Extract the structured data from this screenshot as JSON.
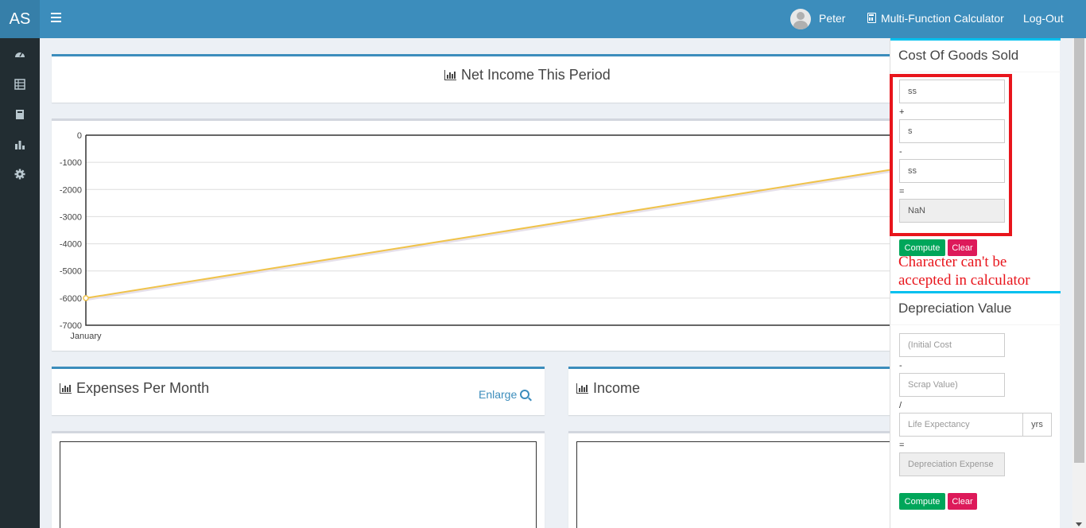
{
  "app": {
    "logo": "AS"
  },
  "header": {
    "user_name": "Peter",
    "calculator_label": "Multi-Function Calculator",
    "logout_label": "Log-Out"
  },
  "sidebar": {
    "items": [
      {
        "icon": "dashboard-icon"
      },
      {
        "icon": "table-icon"
      },
      {
        "icon": "book-icon"
      },
      {
        "icon": "bar-chart-icon"
      },
      {
        "icon": "gear-icon"
      }
    ]
  },
  "net_income": {
    "title": "Net Income This Period"
  },
  "chart_data": {
    "type": "line",
    "title": "",
    "categories": [
      "January"
    ],
    "yticks": [
      "0",
      "-1000",
      "-2000",
      "-3000",
      "-4000",
      "-5000",
      "-6000",
      "-7000"
    ],
    "ylim": [
      -7000,
      0
    ],
    "series": [
      {
        "values": [
          -6000
        ],
        "color": "#f0c34a"
      }
    ],
    "grid": true
  },
  "expenses": {
    "title": "Expenses Per Month",
    "enlarge_label": "Enlarge"
  },
  "income": {
    "title": "Income"
  },
  "cogs": {
    "title": "Cost Of Goods Sold",
    "field1_value": "ss",
    "op1": "+",
    "field2_value": "s",
    "op2": "-",
    "field3_value": "ss",
    "op3": "=",
    "result_value": "NaN",
    "compute_label": "Compute",
    "clear_label": "Clear"
  },
  "annotation": "Character can't be accepted in calculator",
  "depreciation": {
    "title": "Depreciation Value",
    "initial_cost_placeholder": "(Initial Cost",
    "op1": "-",
    "scrap_placeholder": "Scrap Value)",
    "op2": "/",
    "life_placeholder": "Life Expectancy",
    "life_unit": "yrs",
    "op3": "=",
    "result_placeholder": "Depreciation Expense",
    "compute_label": "Compute",
    "clear_label": "Clear"
  },
  "colors": {
    "header": "#3c8dbc",
    "sidebar": "#222d32",
    "accent_box": "#00c0ef",
    "compute": "#00a65a",
    "clear": "#dd1a5a",
    "annotation": "#e8151c"
  }
}
